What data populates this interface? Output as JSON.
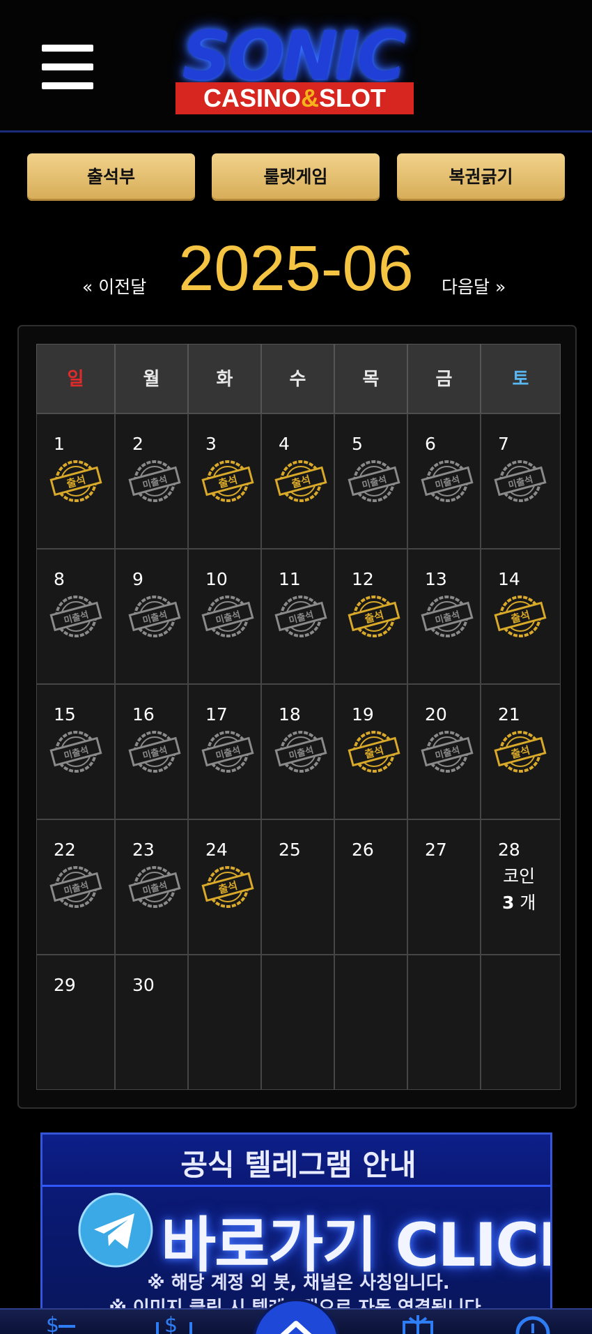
{
  "header": {
    "logo_title": "SONIC",
    "logo_sub_left": "CASINO",
    "logo_sub_amp": "&",
    "logo_sub_right": "SLOT"
  },
  "tabs": [
    {
      "label": "출석부"
    },
    {
      "label": "룰렛게임"
    },
    {
      "label": "복권긁기"
    }
  ],
  "month_nav": {
    "prev": "« 이전달",
    "title": "2025-06",
    "next": "다음달 »"
  },
  "weekdays": [
    "일",
    "월",
    "화",
    "수",
    "목",
    "금",
    "토"
  ],
  "colors": {
    "sunday": "#e02b2b",
    "saturday": "#59b7f2",
    "stamp_attended": "#d9a92a",
    "stamp_absent": "#8a8a8a",
    "month_title": "#f5c443"
  },
  "stamp_labels": {
    "attended": "출석",
    "absent": "미출석"
  },
  "days": [
    {
      "day": "1",
      "status": "attended"
    },
    {
      "day": "2",
      "status": "absent"
    },
    {
      "day": "3",
      "status": "attended"
    },
    {
      "day": "4",
      "status": "attended"
    },
    {
      "day": "5",
      "status": "absent"
    },
    {
      "day": "6",
      "status": "absent"
    },
    {
      "day": "7",
      "status": "absent"
    },
    {
      "day": "8",
      "status": "absent"
    },
    {
      "day": "9",
      "status": "absent"
    },
    {
      "day": "10",
      "status": "absent"
    },
    {
      "day": "11",
      "status": "absent"
    },
    {
      "day": "12",
      "status": "attended"
    },
    {
      "day": "13",
      "status": "absent"
    },
    {
      "day": "14",
      "status": "attended"
    },
    {
      "day": "15",
      "status": "absent"
    },
    {
      "day": "16",
      "status": "absent"
    },
    {
      "day": "17",
      "status": "absent"
    },
    {
      "day": "18",
      "status": "absent"
    },
    {
      "day": "19",
      "status": "attended"
    },
    {
      "day": "20",
      "status": "absent"
    },
    {
      "day": "21",
      "status": "attended"
    },
    {
      "day": "22",
      "status": "absent"
    },
    {
      "day": "23",
      "status": "absent"
    },
    {
      "day": "24",
      "status": "attended"
    },
    {
      "day": "25",
      "status": "none"
    },
    {
      "day": "26",
      "status": "none"
    },
    {
      "day": "27",
      "status": "none"
    },
    {
      "day": "28",
      "status": "coin",
      "coin_label": "코인",
      "coin_count": "3",
      "coin_unit": "개"
    },
    {
      "day": "29",
      "status": "none"
    },
    {
      "day": "30",
      "status": "none"
    },
    {
      "day": "",
      "status": "empty"
    },
    {
      "day": "",
      "status": "empty"
    },
    {
      "day": "",
      "status": "empty"
    },
    {
      "day": "",
      "status": "empty"
    },
    {
      "day": "",
      "status": "empty"
    }
  ],
  "banner": {
    "title": "공식 텔레그램 안내",
    "cta": "바로가기 CLICK",
    "note1": "※ 해당 계정 외 봇, 채널은 사칭입니다.",
    "note2": "※ 이미지 클릭 시 텔레그램으로 자동 연결됩니다."
  },
  "bottom_nav": {
    "icons": [
      "deposit-icon",
      "withdraw-icon",
      "home-icon",
      "gift-icon",
      "history-icon"
    ]
  }
}
